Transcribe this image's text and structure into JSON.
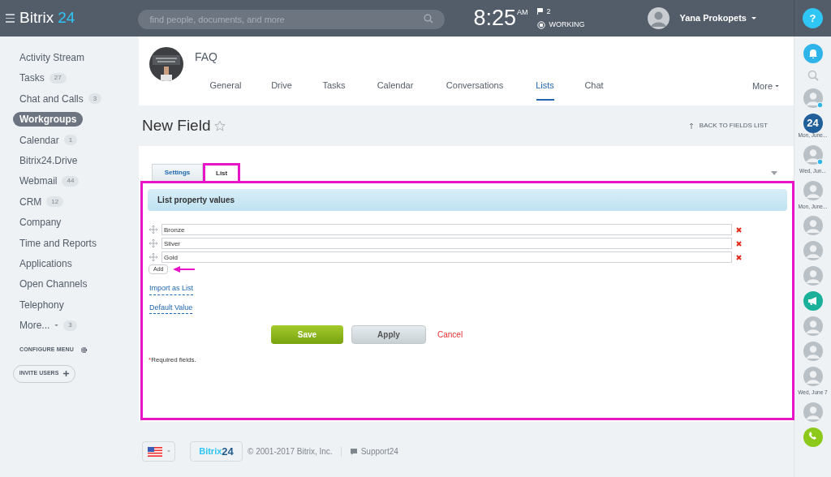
{
  "header": {
    "logo": {
      "name": "Bitrix",
      "number": "24"
    },
    "search": {
      "placeholder": "find people, documents, and more"
    },
    "clock": {
      "time": "8:25",
      "period": "AM"
    },
    "flags": "2",
    "work_status": "WORKING",
    "user": "Yana Prokopets",
    "help": "?"
  },
  "sidebar": {
    "items": [
      {
        "label": "Activity Stream",
        "selected": false
      },
      {
        "label": "Tasks",
        "count": "27",
        "selected": false
      },
      {
        "label": "Chat and Calls",
        "count": "3",
        "selected": false
      },
      {
        "label": "Workgroups",
        "selected": true
      },
      {
        "label": "Calendar",
        "count": "1",
        "selected": false
      },
      {
        "label": "Bitrix24.Drive",
        "selected": false
      },
      {
        "label": "Webmail",
        "count": "44",
        "selected": false
      },
      {
        "label": "CRM",
        "count": "12",
        "selected": false
      },
      {
        "label": "Company",
        "selected": false
      },
      {
        "label": "Time and Reports",
        "selected": false
      },
      {
        "label": "Applications",
        "selected": false
      },
      {
        "label": "Open Channels",
        "selected": false
      },
      {
        "label": "Telephony",
        "selected": false
      },
      {
        "label": "More...",
        "count": "3",
        "selected": false,
        "dropdown": true
      }
    ],
    "configure": "CONFIGURE MENU",
    "invite": "INVITE USERS"
  },
  "group": {
    "name": "FAQ",
    "tabs": [
      {
        "label": "General",
        "selected": false
      },
      {
        "label": "Drive",
        "selected": false
      },
      {
        "label": "Tasks",
        "selected": false
      },
      {
        "label": "Calendar",
        "selected": false
      },
      {
        "label": "Conversations",
        "selected": false
      },
      {
        "label": "Lists",
        "selected": true
      },
      {
        "label": "Chat",
        "selected": false
      }
    ],
    "more": "More"
  },
  "page": {
    "title": "New Field",
    "back": "BACK TO FIELDS LIST"
  },
  "form": {
    "tabs": [
      {
        "label": "Settings",
        "selected": false
      },
      {
        "label": "List",
        "selected": true
      }
    ],
    "section": "List property values",
    "values": [
      "Bronze",
      "Silver",
      "Gold"
    ],
    "add": "Add",
    "links": [
      "Import as List",
      "Default Value"
    ],
    "buttons": {
      "save": "Save",
      "apply": "Apply",
      "cancel": "Cancel"
    },
    "required_note": {
      "mark": "*",
      "text": "Required fields."
    }
  },
  "footer": {
    "logo": {
      "name": "Bitrix",
      "number": "24"
    },
    "copyright": "© 2001-2017 Bitrix, Inc.",
    "support": "Support24"
  },
  "right_bar": [
    {
      "kind": "bell"
    },
    {
      "kind": "search"
    },
    {
      "kind": "avatar",
      "online": true
    },
    {
      "kind": "logo",
      "text": "24"
    },
    {
      "kind": "date",
      "text": "Mon, June..."
    },
    {
      "kind": "avatar",
      "online": true
    },
    {
      "kind": "date",
      "text": "Wed, Jun..."
    },
    {
      "kind": "avatar",
      "online": false
    },
    {
      "kind": "date",
      "text": "Mon, June..."
    },
    {
      "kind": "avatar",
      "online": false
    },
    {
      "kind": "avatar",
      "online": false
    },
    {
      "kind": "avatar",
      "online": false
    },
    {
      "kind": "megaphone"
    },
    {
      "kind": "avatar",
      "online": false
    },
    {
      "kind": "avatar",
      "online": false
    },
    {
      "kind": "avatar",
      "online": false
    },
    {
      "kind": "date",
      "text": "Wed, June 7"
    },
    {
      "kind": "avatar",
      "online": false
    },
    {
      "kind": "phone"
    }
  ]
}
